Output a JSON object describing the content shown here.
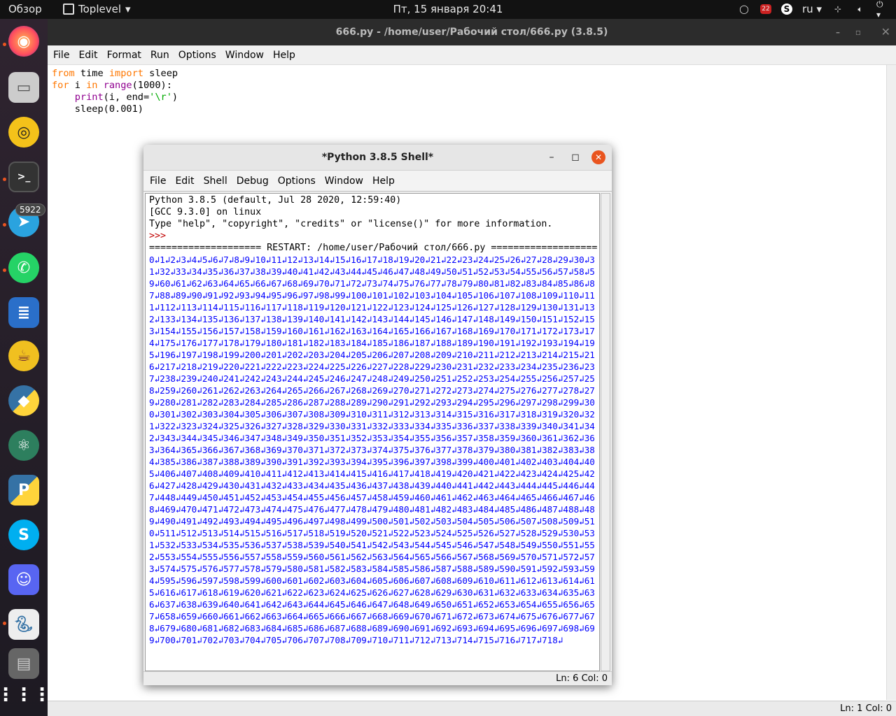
{
  "topbar": {
    "overview": "Обзор",
    "app_name": "Toplevel",
    "clock": "Пт, 15 января  20:41",
    "language": "ru",
    "notification_count": "22"
  },
  "dock": {
    "telegram_badge": "5922",
    "apps": [
      "firefox-icon",
      "files-icon",
      "rhythmbox-icon",
      "terminal-icon",
      "telegram-icon",
      "whatsapp-icon",
      "writer-icon",
      "teapot-icon",
      "python-icon",
      "atom-icon",
      "pycharm-icon",
      "skype-icon",
      "discord-icon",
      "idle-icon",
      "drive-icon",
      "show-apps-icon"
    ]
  },
  "editor": {
    "title": "666.py - /home/user/Рабочий стол/666.py (3.8.5)",
    "menu": [
      "File",
      "Edit",
      "Format",
      "Run",
      "Options",
      "Window",
      "Help"
    ],
    "code": {
      "l1_kw1": "from",
      "l1_a": " time ",
      "l1_kw2": "import",
      "l1_b": " sleep",
      "l2_kw1": "for",
      "l2_a": " i ",
      "l2_kw2": "in",
      "l2_sp": " ",
      "l2_bi": "range",
      "l2_b": "(1000):",
      "l3_ind": "    ",
      "l3_bi": "print",
      "l3_a": "(i, end=",
      "l3_st": "'\\r'",
      "l3_b": ")",
      "l4": "    sleep(0.001)"
    },
    "status": "Ln: 1   Col: 0"
  },
  "shell": {
    "title": "*Python 3.8.5 Shell*",
    "menu": [
      "File",
      "Edit",
      "Shell",
      "Debug",
      "Options",
      "Window",
      "Help"
    ],
    "banner1": "Python 3.8.5 (default, Jul 28 2020, 12:59:40)",
    "banner2": "[GCC 9.3.0] on linux",
    "banner3": "Type \"help\", \"copyright\", \"credits\" or \"license()\" for more information.",
    "prompt": ">>>",
    "restart": "==================== RESTART: /home/user/Рабочий стол/666.py ===================",
    "output_last": 718,
    "status": "Ln: 6   Col: 0"
  }
}
